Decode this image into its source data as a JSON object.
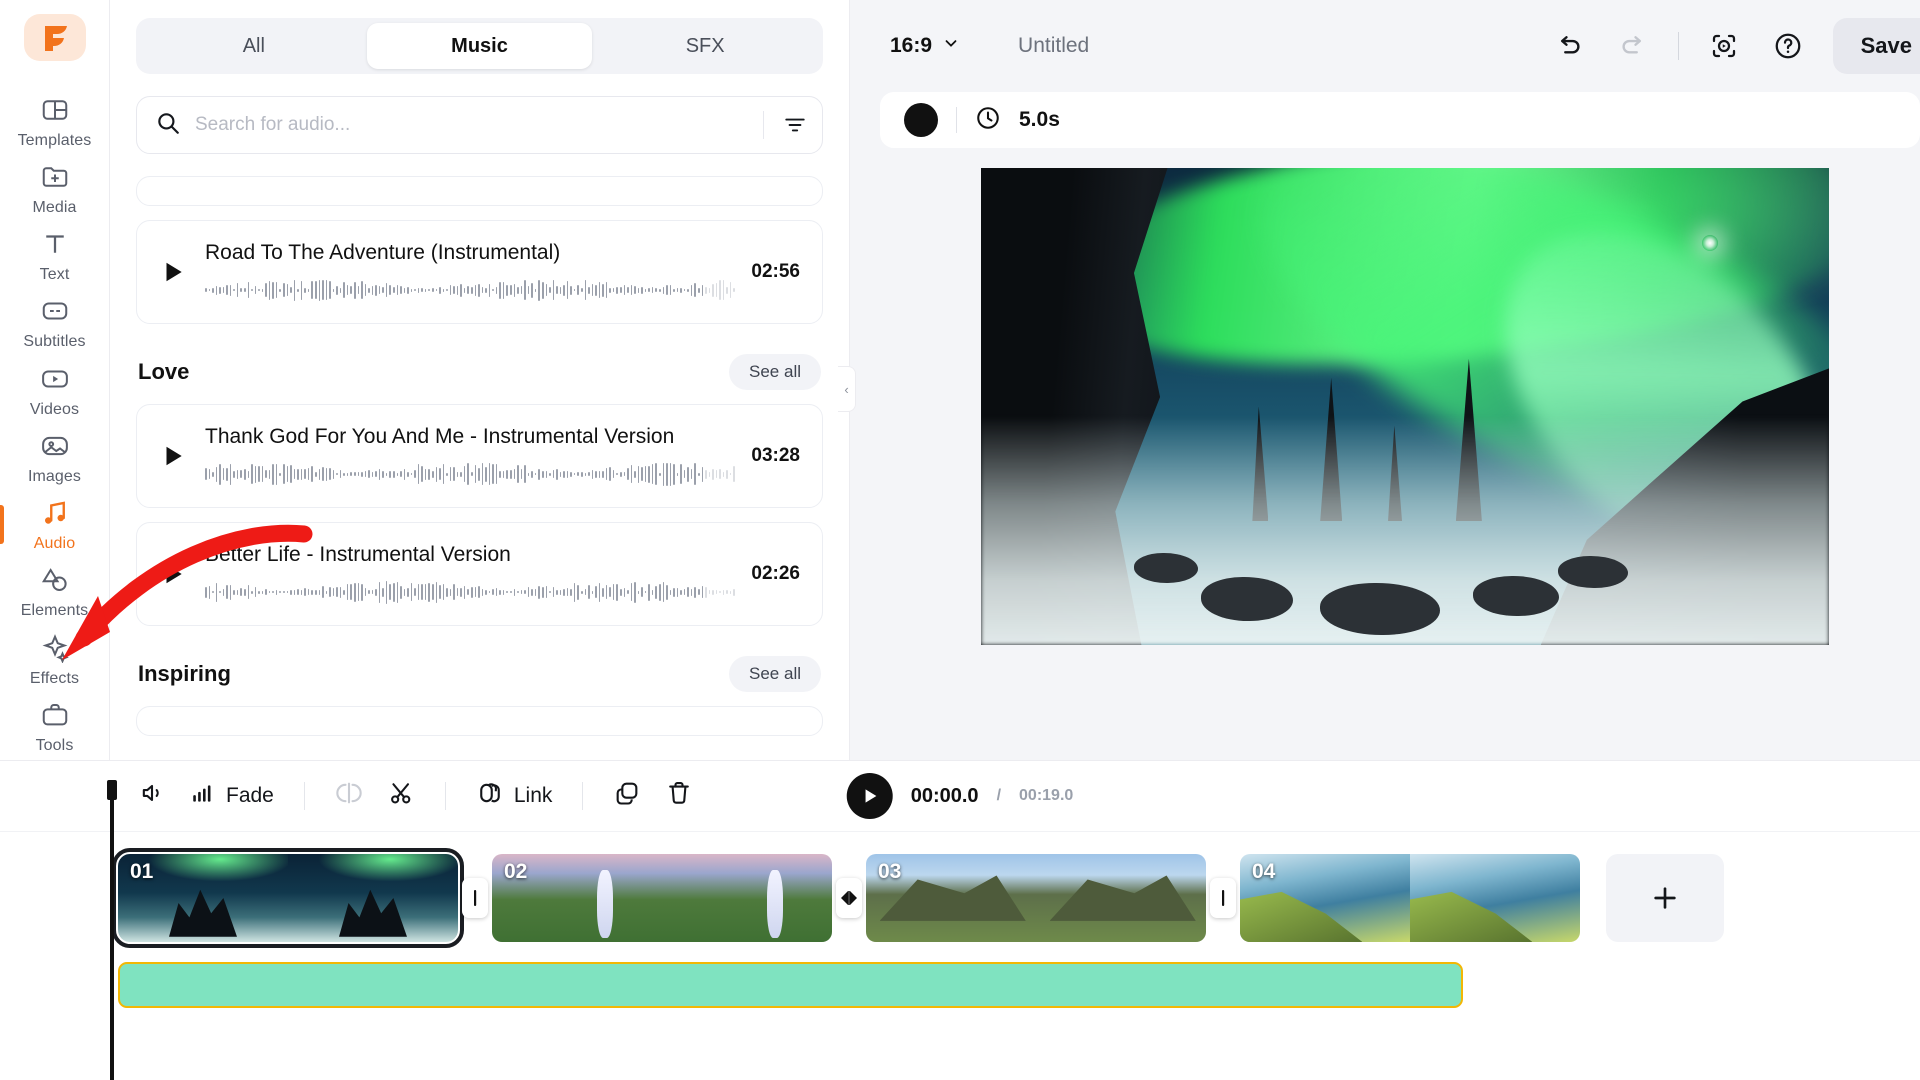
{
  "brand": {
    "logo_glyph": "F",
    "accent": "#f2731c",
    "logo_bg": "#fde7d8"
  },
  "sidebar": {
    "items": [
      {
        "label": "Templates",
        "icon": "templates-icon",
        "active": false
      },
      {
        "label": "Media",
        "icon": "media-folder-plus-icon",
        "active": false
      },
      {
        "label": "Text",
        "icon": "text-icon",
        "active": false
      },
      {
        "label": "Subtitles",
        "icon": "subtitles-icon",
        "active": false
      },
      {
        "label": "Videos",
        "icon": "videos-play-icon",
        "active": false
      },
      {
        "label": "Images",
        "icon": "images-icon",
        "active": false
      },
      {
        "label": "Audio",
        "icon": "audio-note-icon",
        "active": true
      },
      {
        "label": "Elements",
        "icon": "elements-shapes-icon",
        "active": false
      },
      {
        "label": "Effects",
        "icon": "effects-sparkle-icon",
        "active": false
      },
      {
        "label": "Tools",
        "icon": "tools-briefcase-icon",
        "active": false
      }
    ]
  },
  "panel": {
    "tabs": [
      {
        "label": "All",
        "active": false
      },
      {
        "label": "Music",
        "active": true
      },
      {
        "label": "SFX",
        "active": false
      }
    ],
    "search": {
      "placeholder": "Search for audio...",
      "value": "",
      "icon": "search-icon"
    },
    "filter_icon": "filter-icon",
    "tracks_top": [
      {
        "title": "Road To The Adventure (Instrumental)",
        "duration": "02:56"
      }
    ],
    "sections": [
      {
        "title": "Love",
        "see_all": "See all",
        "tracks": [
          {
            "title": "Thank God For You And Me - Instrumental Version",
            "duration": "03:28"
          },
          {
            "title": "Better Life - Instrumental Version",
            "duration": "02:26"
          }
        ]
      },
      {
        "title": "Inspiring",
        "see_all": "See all",
        "tracks": []
      }
    ],
    "collapse_icon": "chevron-left-icon"
  },
  "header": {
    "aspect_ratio": "16:9",
    "aspect_caret": "chevron-down-icon",
    "project_title": "Untitled",
    "actions": [
      {
        "name": "undo-button",
        "icon": "undo-icon",
        "disabled": false
      },
      {
        "name": "redo-button",
        "icon": "redo-icon",
        "disabled": true
      },
      {
        "name": "preview-button",
        "icon": "preview-focus-icon",
        "disabled": false
      },
      {
        "name": "help-button",
        "icon": "help-circle-icon",
        "disabled": false
      }
    ],
    "save_label": "Save"
  },
  "duration_bar": {
    "color_swatch": "#111111",
    "clock_icon": "clock-icon",
    "duration": "5.0s"
  },
  "toolbar": {
    "items": [
      {
        "label": "",
        "icon": "volume-icon",
        "name": "volume-button",
        "disabled": false
      },
      {
        "label": "Fade",
        "icon": "fade-icon",
        "name": "fade-button",
        "disabled": false
      },
      {
        "label": "",
        "icon": "split-icon",
        "name": "split-button",
        "disabled": true
      },
      {
        "label": "",
        "icon": "scissors-icon",
        "name": "cut-button",
        "disabled": false
      },
      {
        "label": "Link",
        "icon": "link-icon",
        "name": "link-button",
        "disabled": false
      },
      {
        "label": "",
        "icon": "duplicate-icon",
        "name": "duplicate-button",
        "disabled": false
      },
      {
        "label": "",
        "icon": "trash-icon",
        "name": "delete-button",
        "disabled": false
      }
    ]
  },
  "player": {
    "play_icon": "play-icon",
    "current_time": "00:00.0",
    "separator": "/",
    "total_time": "00:19.0"
  },
  "timeline": {
    "clips": [
      {
        "number": "01",
        "selected": true,
        "thumb": "t-aurora",
        "frames": 2
      },
      {
        "number": "02",
        "selected": false,
        "thumb": "t-falls",
        "frames": 2
      },
      {
        "number": "03",
        "selected": false,
        "thumb": "t-hill",
        "frames": 2
      },
      {
        "number": "04",
        "selected": false,
        "thumb": "t-coast",
        "frames": 2
      }
    ],
    "transitions": [
      {
        "icon": "transition-none-icon"
      },
      {
        "icon": "transition-applied-icon"
      },
      {
        "icon": "transition-none-icon"
      }
    ],
    "add_clip_label": "+",
    "audio_track": {
      "color": "#7fe3c0",
      "border_color": "#f2b705"
    }
  },
  "annotation": {
    "arrow_color": "#ee1b16",
    "target": "sidebar-item-audio"
  }
}
